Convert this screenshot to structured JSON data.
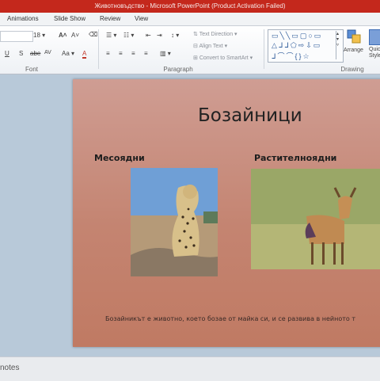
{
  "window": {
    "title": "Животновъдство - Microsoft PowerPoint (Product Activation Failed)"
  },
  "tabs": [
    "Animations",
    "Slide Show",
    "Review",
    "View"
  ],
  "ribbon": {
    "font_size": "18",
    "groups": {
      "font": "Font",
      "paragraph": "Paragraph",
      "drawing": "Drawing"
    },
    "paragraph": {
      "text_direction": "Text Direction",
      "align_text": "Align Text",
      "convert_smartart": "Convert to SmartArt"
    },
    "drawing": {
      "arrange": "Arrange",
      "quick_styles": "Quick Styles"
    }
  },
  "slide": {
    "title": "Бозайници",
    "left_heading": "Месоядни",
    "right_heading": "Растителноядни",
    "caption": "Бозайникът е животно, което бозае от майка си, и се развива в нейното т"
  },
  "statusbar": {
    "notes": "notes"
  },
  "colors": {
    "title_bar": "#c4281c",
    "slide_top": "#cf9d93",
    "slide_bottom": "#c07a63",
    "workspace": "#b8c9d9"
  },
  "icons": {
    "left_photo": "cheetah-photo",
    "right_photo": "deer-photo"
  }
}
